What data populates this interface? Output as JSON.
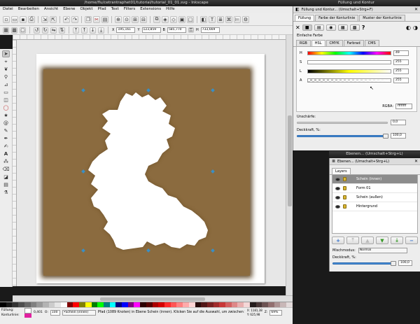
{
  "main_window": {
    "title": "/home/flu/cetrantraphet01/tutorial/tutorial_01_01.svg - Inkscape",
    "menu": [
      "Datei",
      "Bearbeiten",
      "Ansicht",
      "Ebene",
      "Objekt",
      "Pfad",
      "Text",
      "Filters",
      "Extensions",
      "Hilfe"
    ],
    "toolbar": {
      "x_label": "X",
      "x_value": "195,161",
      "y_label": "Y",
      "y_value": "123,859",
      "b_label": "B",
      "b_value": "585,770",
      "h_label": "H",
      "h_value": "733,669"
    },
    "status": {
      "fill_label": "Füllung:",
      "stroke_label": "Konturlinie:",
      "stroke_value": "0,401",
      "opacity_label": "O:",
      "opacity_value": "100",
      "layer_select": "•Schein (innen)",
      "message": "Pfad (1089 Knoten) in Ebene Schein (innen). Klicken Sie auf die Auswahl, um zwischen Skalieren und Rotieren umzuschalten.",
      "coord_x": "X: 1181,38",
      "coord_y": "Y: 625,98",
      "zoom_label": "Z:",
      "zoom_value": "69%"
    }
  },
  "fill_stroke_dialog": {
    "window_title": "Füllung und Kontur",
    "header": "Füllung und Kontur... (Umschalt+Strg+F)",
    "tabs": [
      "Füllung",
      "Farbe der Konturlinie",
      "Muster der Konturlinie"
    ],
    "paint_type_label": "Einfache Farbe",
    "color_mode_tabs": [
      "RGB",
      "HSL",
      "CMYK",
      "Farbrad",
      "CMS"
    ],
    "selected_mode": "HSL",
    "sliders": [
      {
        "label": "H",
        "value": "49"
      },
      {
        "label": "S",
        "value": "255"
      },
      {
        "label": "L",
        "value": "255"
      },
      {
        "label": "A",
        "value": "255"
      }
    ],
    "rgba_label": "RGBA:",
    "rgba_value": "ffffffff",
    "blur_label": "Unschärfe:",
    "blur_value": "0,0",
    "opacity_label": "Deckkraft, %:",
    "opacity_value": "100,0"
  },
  "layers_dialog": {
    "window_title": "Ebenen... (Umschalt+Strg+L)",
    "header": "Ebenen... (Umschalt+Strg+L)",
    "tab": "Layers",
    "layers": [
      {
        "name": "Schein (innen)",
        "selected": true
      },
      {
        "name": "Form 01",
        "selected": false
      },
      {
        "name": "Schein (außen)",
        "selected": false
      },
      {
        "name": "Hintergrund",
        "selected": false
      }
    ],
    "blend_label": "Mischmodus:",
    "blend_value": "Normal",
    "opacity_label": "Deckkraft, %:",
    "opacity_value": "100,0"
  },
  "colors": {
    "background_rect": "#8b6b3f",
    "handle": "#3a8fc4",
    "canvas": "#e7e7e7"
  }
}
